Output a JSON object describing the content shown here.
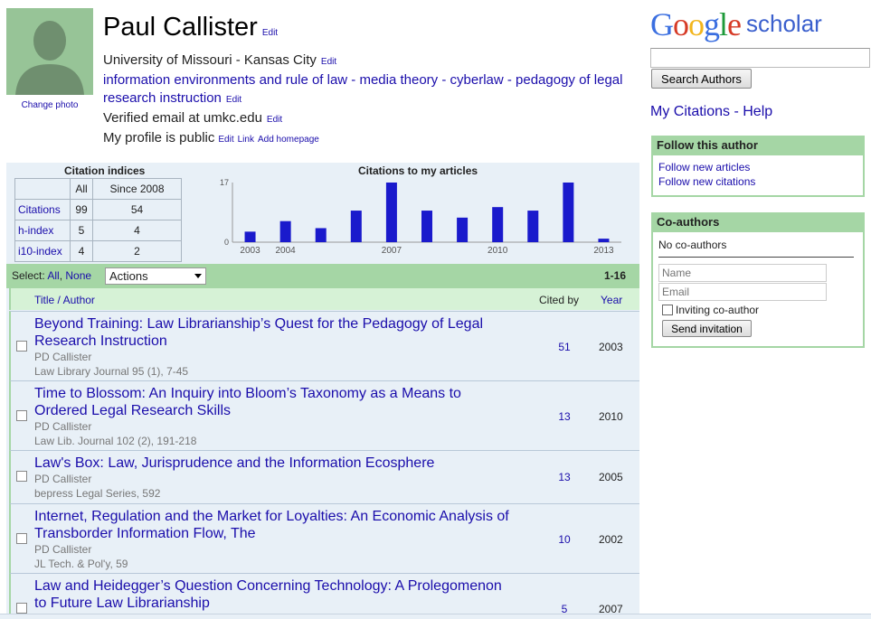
{
  "profile": {
    "name": "Paul Callister",
    "name_edit": "Edit",
    "change_photo": "Change photo",
    "affiliation": "University of Missouri - Kansas City",
    "affiliation_edit": "Edit",
    "interests": "information environments and rule of law - media theory - cyberlaw - pedagogy of legal research instruction",
    "interests_edit": "Edit",
    "email": "Verified email at umkc.edu",
    "email_edit": "Edit",
    "visibility": "My profile is public",
    "visibility_edit": "Edit",
    "visibility_link": "Link",
    "add_homepage": "Add homepage"
  },
  "sidebar": {
    "logo_google": "Google",
    "logo_scholar": "scholar",
    "search_button": "Search Authors",
    "my_citations": "My Citations - Help",
    "follow": {
      "header": "Follow this author",
      "articles": "Follow new articles",
      "citations": "Follow new citations"
    },
    "coauthors": {
      "header": "Co-authors",
      "none": "No co-authors",
      "name_placeholder": "Name",
      "email_placeholder": "Email",
      "inviting": "Inviting co-author",
      "send": "Send invitation"
    }
  },
  "citation_indices": {
    "title": "Citation indices",
    "col_all": "All",
    "col_since": "Since 2008",
    "rows": [
      {
        "label": "Citations",
        "all": "99",
        "since": "54"
      },
      {
        "label": "h-index",
        "all": "5",
        "since": "4"
      },
      {
        "label": "i10-index",
        "all": "4",
        "since": "2"
      }
    ]
  },
  "chart_data": {
    "type": "bar",
    "title": "Citations to my articles",
    "categories": [
      "2003",
      "2004",
      "2005",
      "2006",
      "2007",
      "2008",
      "2009",
      "2010",
      "2011",
      "2012",
      "2013"
    ],
    "values": [
      3,
      6,
      4,
      9,
      17,
      9,
      7,
      10,
      9,
      17,
      1
    ],
    "x_tick_labels": [
      "2003",
      "2004",
      "2007",
      "2010",
      "2013"
    ],
    "y_tick_labels": [
      "0",
      "17"
    ],
    "ylim": [
      0,
      17
    ],
    "bar_color": "#1a1acc"
  },
  "toolbar": {
    "select": "Select:",
    "all": "All",
    "none": "None",
    "actions": "Actions",
    "range": "1-16"
  },
  "columns": {
    "title": "Title / Author",
    "cited_by": "Cited by",
    "year": "Year"
  },
  "publications": [
    {
      "title": "Beyond Training: Law Librarianship’s Quest for the Pedagogy of Legal Research Instruction",
      "authors": "PD Callister",
      "venue": "Law Library Journal 95 (1), 7-45",
      "cited_by": "51",
      "year": "2003"
    },
    {
      "title": "Time to Blossom: An Inquiry into Bloom’s Taxonomy as a Means to Ordered Legal Research Skills",
      "authors": "PD Callister",
      "venue": "Law Lib. Journal 102 (2), 191-218",
      "cited_by": "13",
      "year": "2010"
    },
    {
      "title": "Law's Box: Law, Jurisprudence and the Information Ecosphere",
      "authors": "PD Callister",
      "venue": "bepress Legal Series, 592",
      "cited_by": "13",
      "year": "2005"
    },
    {
      "title": "Internet, Regulation and the Market for Loyalties: An Economic Analysis of Transborder Information Flow, The",
      "authors": "PD Callister",
      "venue": "JL Tech. & Pol'y, 59",
      "cited_by": "10",
      "year": "2002"
    },
    {
      "title": "Law and Heidegger’s Question Concerning Technology: A Prolegomenon to Future Law Librarianship",
      "authors": "",
      "venue": "",
      "cited_by": "5",
      "year": "2007"
    }
  ]
}
